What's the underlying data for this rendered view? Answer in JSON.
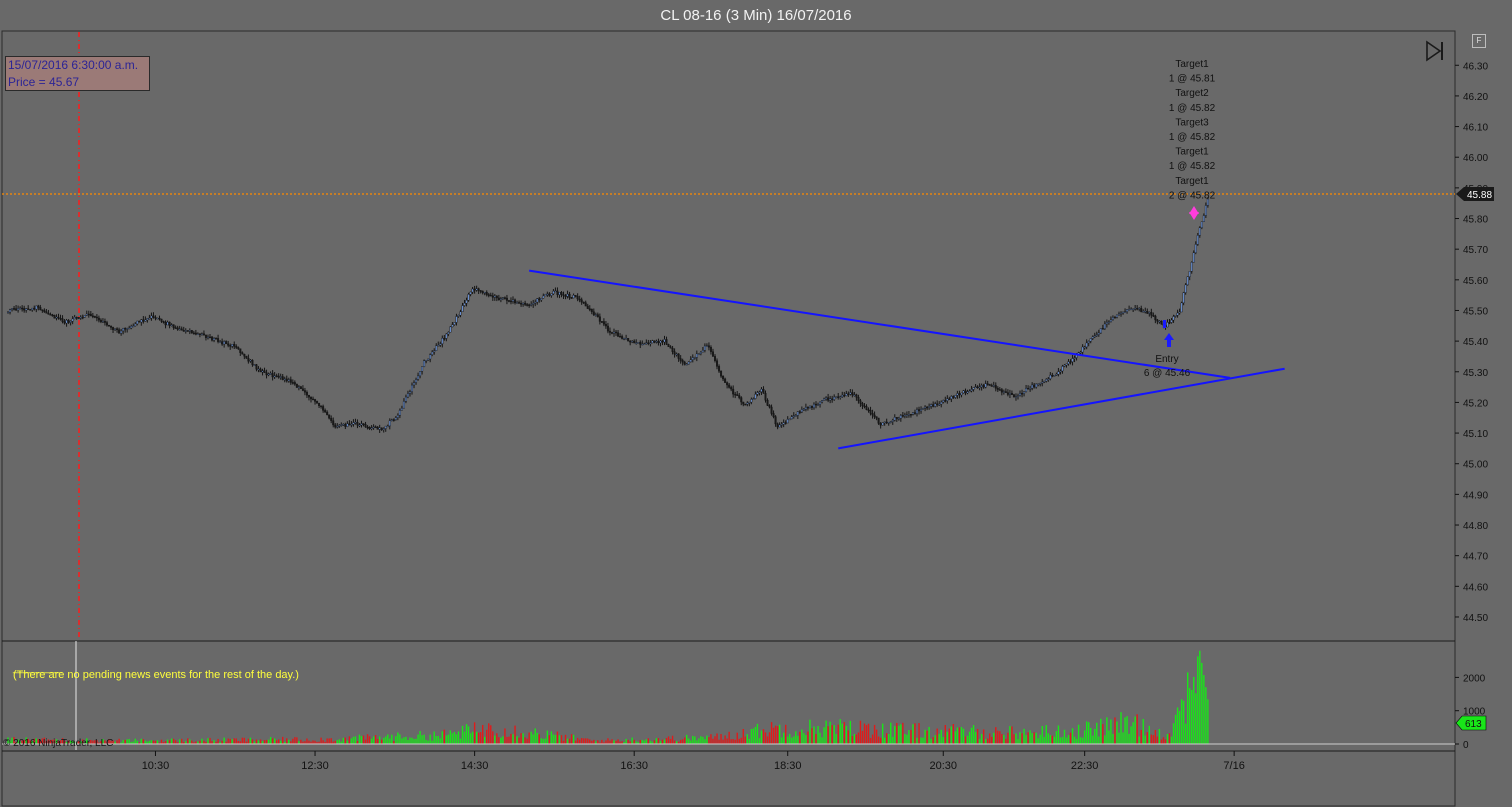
{
  "window": {
    "title": "CL 08-16 (3 Min)  16/07/2016"
  },
  "crosshair": {
    "date_label": "15/07/2016 6:30:00 a.m.",
    "price_label": "Price = 45.67"
  },
  "news": {
    "rule": "________",
    "message": "(There are no pending news events for the rest of the day.)"
  },
  "copyright": "© 2016 NinjaTrader, LLC",
  "panel_button": "F",
  "colors": {
    "background": "#696969",
    "bull": "#6a8fcf",
    "bear": "#1a1a1a",
    "trendline": "#1414ff",
    "vol_up": "#19e619",
    "vol_down": "#e01b1b",
    "price_line": "#ff8c00",
    "crosshair": "#ff1a1a",
    "marker": "#ff3cdc",
    "entry_arrow": "#1a1aff"
  },
  "icons": {
    "play": "skip-forward-icon"
  },
  "chart_data": [
    {
      "type": "candlestick",
      "title": "CL 08-16 (3 Min)  16/07/2016",
      "ylim": [
        44.45,
        46.35
      ],
      "yticks": [
        "46.30",
        "46.20",
        "46.10",
        "46.00",
        "45.90",
        "45.80",
        "45.70",
        "45.60",
        "45.50",
        "45.40",
        "45.30",
        "45.20",
        "45.10",
        "45.00",
        "44.90",
        "44.80",
        "44.70",
        "44.60",
        "44.50"
      ],
      "xticks": [
        "10:30",
        "12:30",
        "14:30",
        "16:30",
        "18:30",
        "20:30",
        "22:30",
        "7/16"
      ],
      "current_price": "45.88",
      "crosshair_price": 45.67,
      "keypoints": [
        {
          "x": 0,
          "y": 45.5
        },
        {
          "x": 15,
          "y": 45.51
        },
        {
          "x": 28,
          "y": 45.46
        },
        {
          "x": 40,
          "y": 45.49
        },
        {
          "x": 55,
          "y": 45.43
        },
        {
          "x": 70,
          "y": 45.48
        },
        {
          "x": 85,
          "y": 45.44
        },
        {
          "x": 100,
          "y": 45.41
        },
        {
          "x": 113,
          "y": 45.38
        },
        {
          "x": 125,
          "y": 45.3
        },
        {
          "x": 140,
          "y": 45.27
        },
        {
          "x": 153,
          "y": 45.2
        },
        {
          "x": 162,
          "y": 45.12
        },
        {
          "x": 172,
          "y": 45.13
        },
        {
          "x": 185,
          "y": 45.11
        },
        {
          "x": 193,
          "y": 45.16
        },
        {
          "x": 206,
          "y": 45.33
        },
        {
          "x": 218,
          "y": 45.43
        },
        {
          "x": 230,
          "y": 45.57
        },
        {
          "x": 243,
          "y": 45.54
        },
        {
          "x": 258,
          "y": 45.52
        },
        {
          "x": 270,
          "y": 45.56
        },
        {
          "x": 283,
          "y": 45.54
        },
        {
          "x": 298,
          "y": 45.43
        },
        {
          "x": 312,
          "y": 45.39
        },
        {
          "x": 325,
          "y": 45.4
        },
        {
          "x": 336,
          "y": 45.32
        },
        {
          "x": 346,
          "y": 45.39
        },
        {
          "x": 355,
          "y": 45.26
        },
        {
          "x": 365,
          "y": 45.19
        },
        {
          "x": 373,
          "y": 45.24
        },
        {
          "x": 381,
          "y": 45.12
        },
        {
          "x": 392,
          "y": 45.17
        },
        {
          "x": 405,
          "y": 45.21
        },
        {
          "x": 418,
          "y": 45.23
        },
        {
          "x": 432,
          "y": 45.13
        },
        {
          "x": 445,
          "y": 45.16
        },
        {
          "x": 458,
          "y": 45.19
        },
        {
          "x": 472,
          "y": 45.23
        },
        {
          "x": 485,
          "y": 45.26
        },
        {
          "x": 498,
          "y": 45.22
        },
        {
          "x": 512,
          "y": 45.27
        },
        {
          "x": 520,
          "y": 45.3
        },
        {
          "x": 530,
          "y": 45.36
        },
        {
          "x": 538,
          "y": 45.42
        },
        {
          "x": 548,
          "y": 45.48
        },
        {
          "x": 556,
          "y": 45.51
        },
        {
          "x": 565,
          "y": 45.49
        },
        {
          "x": 573,
          "y": 45.45
        },
        {
          "x": 580,
          "y": 45.5
        },
        {
          "x": 586,
          "y": 45.66
        },
        {
          "x": 590,
          "y": 45.77
        },
        {
          "x": 594,
          "y": 45.86
        }
      ],
      "volume": {
        "ylim": [
          0,
          3000
        ],
        "yticks": [
          "2000",
          "1000",
          "0"
        ],
        "current_label": "613",
        "keypoints": [
          {
            "x": 0,
            "y": 150
          },
          {
            "x": 60,
            "y": 110
          },
          {
            "x": 160,
            "y": 160
          },
          {
            "x": 215,
            "y": 300
          },
          {
            "x": 240,
            "y": 550
          },
          {
            "x": 290,
            "y": 110
          },
          {
            "x": 350,
            "y": 220
          },
          {
            "x": 380,
            "y": 520
          },
          {
            "x": 410,
            "y": 540
          },
          {
            "x": 450,
            "y": 440
          },
          {
            "x": 500,
            "y": 380
          },
          {
            "x": 530,
            "y": 430
          },
          {
            "x": 556,
            "y": 720
          },
          {
            "x": 575,
            "y": 280
          },
          {
            "x": 590,
            "y": 2800
          },
          {
            "x": 596,
            "y": 613
          }
        ]
      },
      "trendlines": [
        {
          "from": {
            "x": 258,
            "y": 45.63
          },
          "to": {
            "x": 605,
            "y": 45.28
          }
        },
        {
          "from": {
            "x": 411,
            "y": 45.05
          },
          "to": {
            "x": 632,
            "y": 45.31
          }
        }
      ],
      "annotations": {
        "targets": [
          "Target1",
          "1 @ 45.81",
          "Target2",
          "1 @ 45.82",
          "Target3",
          "1 @ 45.82",
          "Target1",
          "1 @ 45.82",
          "Target1",
          "2 @ 45.82"
        ],
        "entry": [
          "Entry",
          "6 @ 45.46"
        ]
      }
    }
  ]
}
